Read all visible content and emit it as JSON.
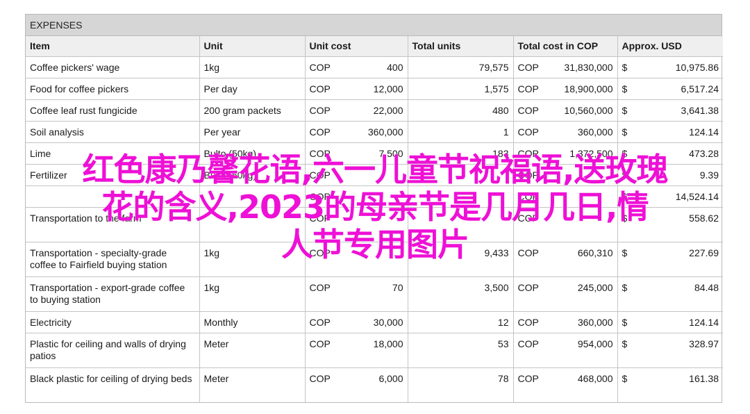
{
  "section_title": "EXPENSES",
  "columns": [
    "Item",
    "Unit",
    "Unit cost",
    "Total units",
    "Total cost in COP",
    "Approx. USD"
  ],
  "currency_cop": "COP",
  "currency_usd": "$",
  "rows": [
    {
      "item": "Coffee pickers' wage",
      "unit": "1kg",
      "unit_cost": "400",
      "total_units": "79,575",
      "total_cop": "31,830,000",
      "usd": "10,975.86"
    },
    {
      "item": "Food for coffee pickers",
      "unit": "Per day",
      "unit_cost": "12,000",
      "total_units": "1,575",
      "total_cop": "18,900,000",
      "usd": "6,517.24"
    },
    {
      "item": "Coffee leaf rust fungicide",
      "unit": "200 gram packets",
      "unit_cost": "22,000",
      "total_units": "480",
      "total_cop": "10,560,000",
      "usd": "3,641.38"
    },
    {
      "item": "Soil analysis",
      "unit": "Per year",
      "unit_cost": "360,000",
      "total_units": "1",
      "total_cop": "360,000",
      "usd": "124.14"
    },
    {
      "item": "Lime",
      "unit": "Bulto (50kg)",
      "unit_cost": "7,500",
      "total_units": "183",
      "total_cop": "1,372,500",
      "usd": "473.28"
    },
    {
      "item": "Fertilizer",
      "unit": "Bulto (50kg)",
      "unit_cost": "",
      "total_units": "",
      "total_cop": "",
      "usd": "9.39"
    },
    {
      "item": "",
      "unit": "",
      "unit_cost": "",
      "total_units": "",
      "total_cop": "",
      "usd": "14,524.14"
    },
    {
      "item": "Transportation to the farm",
      "unit": "",
      "unit_cost": "",
      "total_units": "",
      "total_cop": "",
      "usd": "558.62"
    },
    {
      "item": "Transportation - specialty-grade coffee to Fairfield buying station",
      "unit": "1kg",
      "unit_cost": "",
      "total_units": "9,433",
      "total_cop": "660,310",
      "usd": "227.69"
    },
    {
      "item": "Transportation - export-grade coffee to buying station",
      "unit": "1kg",
      "unit_cost": "70",
      "total_units": "3,500",
      "total_cop": "245,000",
      "usd": "84.48"
    },
    {
      "item": "Electricity",
      "unit": "Monthly",
      "unit_cost": "30,000",
      "total_units": "12",
      "total_cop": "360,000",
      "usd": "124.14"
    },
    {
      "item": "Plastic for ceiling and walls of drying patios",
      "unit": "Meter",
      "unit_cost": "18,000",
      "total_units": "53",
      "total_cop": "954,000",
      "usd": "328.97"
    },
    {
      "item": "Black plastic for ceiling of drying beds",
      "unit": "Meter",
      "unit_cost": "6,000",
      "total_units": "78",
      "total_cop": "468,000",
      "usd": "161.38"
    }
  ],
  "overlay_lines": [
    "红色康乃馨花语,六一儿童节祝福语,送玫瑰",
    "花的含义,2023的母亲节是几月几日,情",
    "人节专用图片"
  ],
  "overlay_color": "#ee10d6"
}
